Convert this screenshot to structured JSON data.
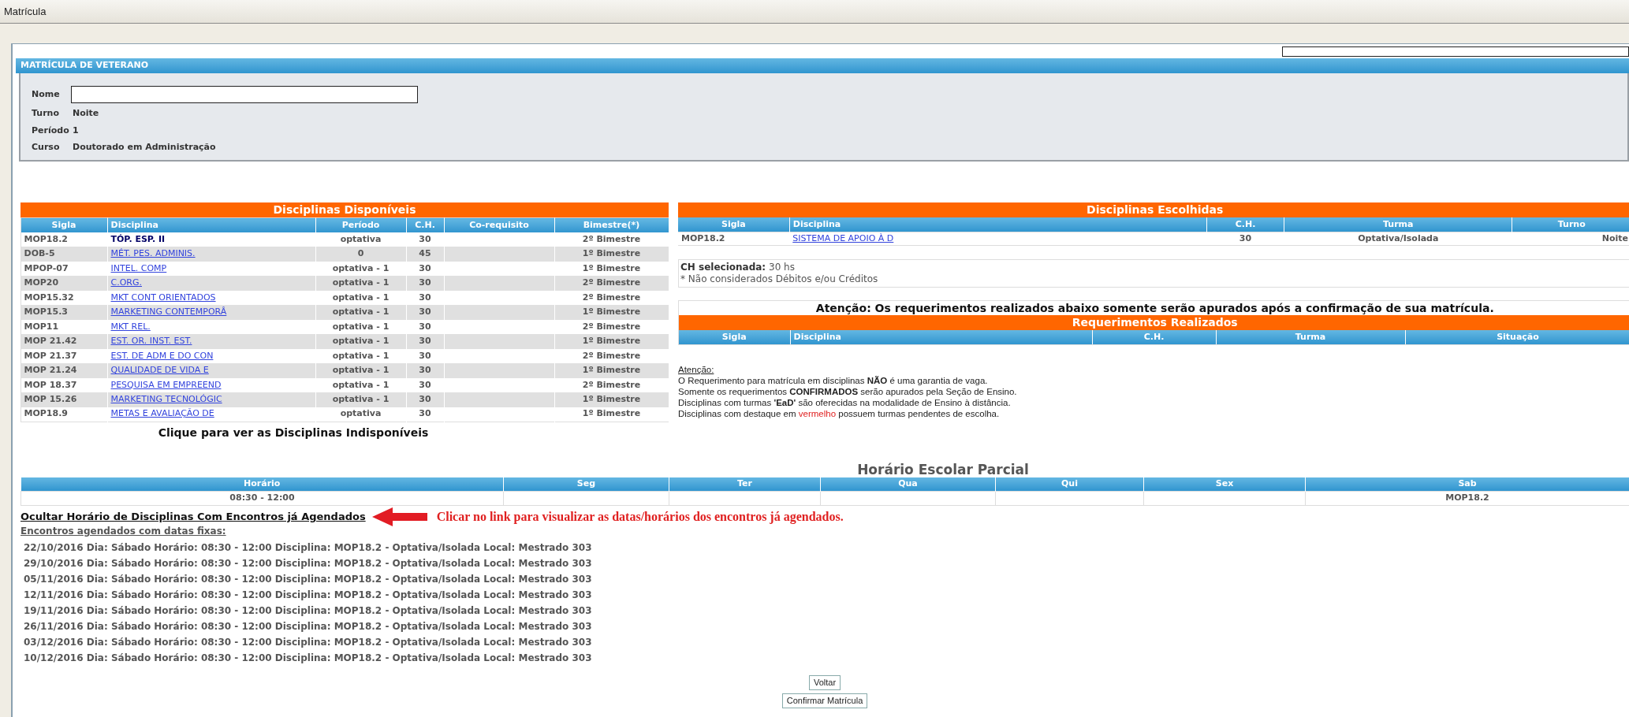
{
  "window": {
    "title": "Matrícula"
  },
  "section_title": "MATRÍCULA DE VETERANO",
  "info": [
    {
      "label": "Nome",
      "kind": "field"
    },
    {
      "label": "Turno",
      "kind": "text",
      "value": "Noite"
    },
    {
      "label": "Período",
      "kind": "text",
      "value": "1"
    },
    {
      "label": "Curso",
      "kind": "text",
      "value": "Doutorado em Administração"
    }
  ],
  "available": {
    "title": "Disciplinas Disponíveis",
    "columns": [
      "Sigla",
      "Disciplina",
      "Período",
      "C.H.",
      "Co-requisito",
      "Bimestre(*)"
    ],
    "rows": [
      {
        "sigla": "MOP18.2",
        "disciplina": "TÓP. ESP. II",
        "linked": false,
        "periodo": "optativa",
        "ch": "30",
        "bimestre": "2º Bimestre"
      },
      {
        "sigla": "DOB-5",
        "disciplina": "MÉT. PES. ADMINIS.",
        "linked": true,
        "periodo": "0",
        "ch": "45",
        "bimestre": "1º Bimestre"
      },
      {
        "sigla": "MPOP-07",
        "disciplina": "INTEL. COMP",
        "linked": true,
        "periodo": "optativa - 1",
        "ch": "30",
        "bimestre": "1º Bimestre"
      },
      {
        "sigla": "MOP20",
        "disciplina": "C.ORG.",
        "linked": true,
        "periodo": "optativa - 1",
        "ch": "30",
        "bimestre": "2º Bimestre"
      },
      {
        "sigla": "MOP15.32",
        "disciplina": "MKT CONT ORIENTADOS",
        "linked": true,
        "periodo": "optativa - 1",
        "ch": "30",
        "bimestre": "2º Bimestre"
      },
      {
        "sigla": "MOP15.3",
        "disciplina": "MARKETING CONTEMPORÂ",
        "linked": true,
        "periodo": "optativa - 1",
        "ch": "30",
        "bimestre": "1º Bimestre"
      },
      {
        "sigla": "MOP11",
        "disciplina": "MKT REL.",
        "linked": true,
        "periodo": "optativa - 1",
        "ch": "30",
        "bimestre": "2º Bimestre"
      },
      {
        "sigla": "MOP 21.42",
        "disciplina": "EST. OR. INST. EST.",
        "linked": true,
        "periodo": "optativa - 1",
        "ch": "30",
        "bimestre": "1º Bimestre"
      },
      {
        "sigla": "MOP 21.37",
        "disciplina": "EST. DE ADM E DO CON",
        "linked": true,
        "periodo": "optativa - 1",
        "ch": "30",
        "bimestre": "2º Bimestre"
      },
      {
        "sigla": "MOP 21.24",
        "disciplina": "QUALIDADE DE VIDA E",
        "linked": true,
        "periodo": "optativa - 1",
        "ch": "30",
        "bimestre": "1º Bimestre"
      },
      {
        "sigla": "MOP 18.37",
        "disciplina": "PESQUISA EM EMPREEND",
        "linked": true,
        "periodo": "optativa - 1",
        "ch": "30",
        "bimestre": "2º Bimestre"
      },
      {
        "sigla": "MOP 15.26",
        "disciplina": "MARKETING TECNOLÓGIC",
        "linked": true,
        "periodo": "optativa - 1",
        "ch": "30",
        "bimestre": "1º Bimestre"
      },
      {
        "sigla": "MOP18.9",
        "disciplina": "METAS E AVALIAÇÃO DE",
        "linked": true,
        "periodo": "optativa",
        "ch": "30",
        "bimestre": "1º Bimestre"
      }
    ],
    "footer_link": "Clique para ver as Disciplinas Indisponíveis"
  },
  "chosen": {
    "title": "Disciplinas Escolhidas",
    "columns": [
      "Sigla",
      "Disciplina",
      "C.H.",
      "Turma",
      "Turno"
    ],
    "rows": [
      {
        "sigla": "MOP18.2",
        "disciplina": "SISTEMA DE APOIO À D",
        "ch": "30",
        "turma": "Optativa/Isolada",
        "turno": "Noite"
      }
    ]
  },
  "ch_summary": {
    "label": "CH selecionada:",
    "value": "30 hs",
    "note": "* Não considerados Débitos e/ou Créditos"
  },
  "requests": {
    "notice": "Atenção: Os requerimentos realizados abaixo somente serão apurados após a confirmação de sua matrícula.",
    "title": "Requerimentos Realizados",
    "columns": [
      "Sigla",
      "Disciplina",
      "C.H.",
      "Turma",
      "Situação"
    ]
  },
  "attention": {
    "heading": "Atenção:",
    "lines": [
      [
        {
          "text": "O Requerimento para matrícula em disciplinas **NÃO** é uma garantia de vaga.",
          "highlight": false
        }
      ],
      [
        {
          "text": "Somente os requerimentos **CONFIRMADOS** serão apurados pela Seção de Ensino.",
          "highlight": false
        }
      ],
      [
        {
          "text": "Disciplinas com turmas **'EaD'** são oferecidas na modalidade de Ensino à distância.",
          "highlight": false
        }
      ],
      [
        {
          "text": "Disciplinas com destaque em ",
          "highlight": false
        },
        {
          "text": "vermelho",
          "highlight": true
        },
        {
          "text": " possuem turmas pendentes de escolha.",
          "highlight": false
        }
      ]
    ]
  },
  "schedule": {
    "title": "Horário Escolar Parcial",
    "columns": [
      "Horário",
      "Seg",
      "Ter",
      "Qua",
      "Qui",
      "Sex",
      "Sab"
    ],
    "rows": [
      [
        "08:30 - 12:00",
        "",
        "",
        "",
        "",
        "",
        "MOP18.2"
      ]
    ]
  },
  "toggle_link": "Ocultar Horário de Disciplinas Com Encontros já Agendados",
  "hint": "Clicar no link para visualizar as datas/horários dos encontros já agendados.",
  "meetings_heading": "Encontros agendados com datas fixas:",
  "meetings": [
    "22/10/2016 Dia: Sábado Horário: 08:30 - 12:00 Disciplina: MOP18.2 - Optativa/Isolada Local: Mestrado 303",
    "29/10/2016 Dia: Sábado Horário: 08:30 - 12:00 Disciplina: MOP18.2 - Optativa/Isolada Local: Mestrado 303",
    "05/11/2016 Dia: Sábado Horário: 08:30 - 12:00 Disciplina: MOP18.2 - Optativa/Isolada Local: Mestrado 303",
    "12/11/2016 Dia: Sábado Horário: 08:30 - 12:00 Disciplina: MOP18.2 - Optativa/Isolada Local: Mestrado 303",
    "19/11/2016 Dia: Sábado Horário: 08:30 - 12:00 Disciplina: MOP18.2 - Optativa/Isolada Local: Mestrado 303",
    "26/11/2016 Dia: Sábado Horário: 08:30 - 12:00 Disciplina: MOP18.2 - Optativa/Isolada Local: Mestrado 303",
    "03/12/2016 Dia: Sábado Horário: 08:30 - 12:00 Disciplina: MOP18.2 - Optativa/Isolada Local: Mestrado 303",
    "10/12/2016 Dia: Sábado Horário: 08:30 - 12:00 Disciplina: MOP18.2 - Optativa/Isolada Local: Mestrado 303"
  ],
  "buttons": [
    "Voltar",
    "Confirmar Matrícula"
  ]
}
